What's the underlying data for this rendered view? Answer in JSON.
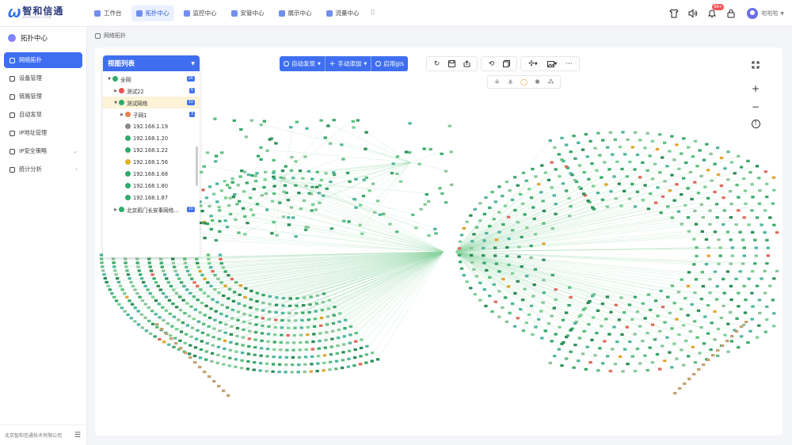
{
  "app": {
    "logo_text": "智和信通",
    "logo_subtext": "ZHIHESOFT.COM",
    "brand_color": "#2f6fe4",
    "accent_color": "#3f6ff0"
  },
  "nav": {
    "items": [
      {
        "label": "工作台",
        "icon": "home-icon",
        "active": false
      },
      {
        "label": "拓扑中心",
        "icon": "topology-icon",
        "active": true
      },
      {
        "label": "监控中心",
        "icon": "monitor-icon",
        "active": false
      },
      {
        "label": "安管中心",
        "icon": "shield-icon",
        "active": false
      },
      {
        "label": "展示中心",
        "icon": "display-icon",
        "active": false
      },
      {
        "label": "流量中心",
        "icon": "traffic-icon",
        "active": false
      }
    ],
    "more_icon": "grid-menu-icon"
  },
  "header_right": {
    "icons": [
      "tshirt-icon",
      "speaker-icon",
      "bell-icon",
      "lock-icon"
    ],
    "notification_badge": "99+",
    "user_name": "啦啦啦"
  },
  "sidebar": {
    "title": "拓扑中心",
    "items": [
      {
        "label": "网络拓扑",
        "active": true,
        "has_arrow": false
      },
      {
        "label": "设备管理",
        "active": false,
        "has_arrow": false
      },
      {
        "label": "链路管理",
        "active": false,
        "has_arrow": false
      },
      {
        "label": "自动发现",
        "active": false,
        "has_arrow": false
      },
      {
        "label": "IP地址管理",
        "active": false,
        "has_arrow": false
      },
      {
        "label": "IP安全策略",
        "active": false,
        "has_arrow": true,
        "arrow": "⌄"
      },
      {
        "label": "统计分析",
        "active": false,
        "has_arrow": true,
        "arrow": "›"
      }
    ],
    "footer": "北京智和信通技术有限公司"
  },
  "breadcrumb": {
    "label": "网络拓扑"
  },
  "view_list": {
    "title": "视图列表",
    "tree": [
      {
        "label": "全网",
        "depth": 0,
        "toggle": "▼",
        "icon_color": "#2eaa6a",
        "count": "26",
        "selected": false
      },
      {
        "label": "测试22",
        "depth": 1,
        "toggle": "▶",
        "icon_color": "#e8524f",
        "count": "5",
        "selected": false
      },
      {
        "label": "测试网络",
        "depth": 1,
        "toggle": "▼",
        "icon_color": "#2eaa6a",
        "count": "10",
        "selected": true
      },
      {
        "label": "子网1",
        "depth": 2,
        "toggle": "▶",
        "icon_color": "#e8824f",
        "count": "3",
        "selected": false
      },
      {
        "label": "192.168.1.19",
        "depth": 2,
        "toggle": "",
        "icon_color": "#888888",
        "count": "",
        "selected": false
      },
      {
        "label": "192.168.1.20",
        "depth": 2,
        "toggle": "",
        "icon_color": "#2eaa6a",
        "count": "",
        "selected": false
      },
      {
        "label": "192.168.1.22",
        "depth": 2,
        "toggle": "",
        "icon_color": "#2eaa6a",
        "count": "",
        "selected": false
      },
      {
        "label": "192.168.1.56",
        "depth": 2,
        "toggle": "",
        "icon_color": "#e0b020",
        "count": "",
        "selected": false
      },
      {
        "label": "192.168.1.68",
        "depth": 2,
        "toggle": "",
        "icon_color": "#2eaa6a",
        "count": "",
        "selected": false
      },
      {
        "label": "192.168.1.80",
        "depth": 2,
        "toggle": "",
        "icon_color": "#2eaa6a",
        "count": "",
        "selected": false
      },
      {
        "label": "192.168.1.87",
        "depth": 2,
        "toggle": "",
        "icon_color": "#2eaa6a",
        "count": "",
        "selected": false
      },
      {
        "label": "北京鸦门长安事网络...",
        "depth": 1,
        "toggle": "▶",
        "icon_color": "#2eaa6a",
        "count": "10",
        "selected": false
      }
    ]
  },
  "toolbar": {
    "auto_discover": "自动发现",
    "manual_add": "手动添加",
    "enable_gis": "启用gis",
    "action_icons": [
      "refresh-icon",
      "save-icon",
      "export-icon"
    ],
    "view_icons": [
      "sync-icon",
      "copy-icon"
    ],
    "layout_icons": [
      "layout-icon",
      "image-icon",
      "more-icon"
    ],
    "layout_sub_icons": [
      "grid-layout-icon",
      "tree-layout-icon",
      "circle-layout-icon",
      "radial-layout-icon",
      "force-layout-icon"
    ],
    "zoom_icons": [
      "zoom-in-icon",
      "zoom-out-icon",
      "info-icon",
      "fullscreen-icon"
    ]
  }
}
